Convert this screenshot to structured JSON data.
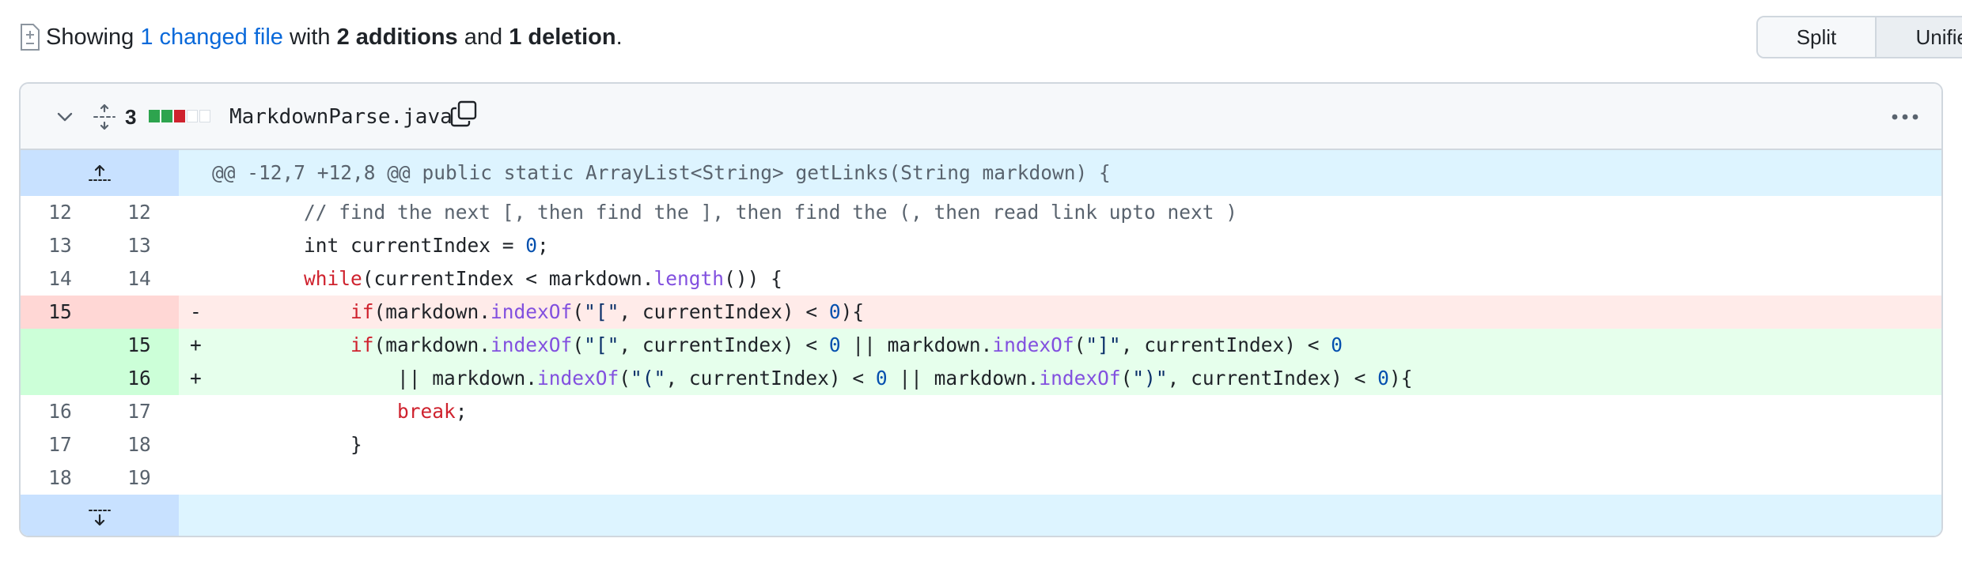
{
  "summary": {
    "prefix": "Showing ",
    "changed_link": "1 changed file",
    "mid1": " with ",
    "additions": "2 additions",
    "mid2": " and ",
    "deletions": "1 deletion",
    "suffix": "."
  },
  "view_toggle": {
    "split": "Split",
    "unified": "Unified",
    "selected": "Unified"
  },
  "file": {
    "change_count": "3",
    "filename": "MarkdownParse.java",
    "diffstat": [
      "green",
      "green",
      "red",
      "gray",
      "gray"
    ],
    "colors": {
      "green": "#2da44e",
      "red": "#cf222e",
      "gray": "#d8dee4"
    }
  },
  "hunk": {
    "header": "@@ -12,7 +12,8 @@ public static ArrayList<String> getLinks(String markdown) {"
  },
  "lines": [
    {
      "type": "ctx",
      "old": "12",
      "new": "12",
      "sign": "",
      "tokens": [
        {
          "t": "        ",
          "c": ""
        },
        {
          "t": "// find the next [, then find the ], then find the (, then read link upto next )",
          "c": "cm"
        }
      ]
    },
    {
      "type": "ctx",
      "old": "13",
      "new": "13",
      "sign": "",
      "tokens": [
        {
          "t": "        int currentIndex = ",
          "c": ""
        },
        {
          "t": "0",
          "c": "num"
        },
        {
          "t": ";",
          "c": ""
        }
      ]
    },
    {
      "type": "ctx",
      "old": "14",
      "new": "14",
      "sign": "",
      "tokens": [
        {
          "t": "        ",
          "c": ""
        },
        {
          "t": "while",
          "c": "kw"
        },
        {
          "t": "(currentIndex < markdown.",
          "c": ""
        },
        {
          "t": "length",
          "c": "fn"
        },
        {
          "t": "()) {",
          "c": ""
        }
      ]
    },
    {
      "type": "del",
      "old": "15",
      "new": "",
      "sign": "-",
      "tokens": [
        {
          "t": "            ",
          "c": ""
        },
        {
          "t": "if",
          "c": "kw"
        },
        {
          "t": "(markdown.",
          "c": ""
        },
        {
          "t": "indexOf",
          "c": "fn"
        },
        {
          "t": "(",
          "c": ""
        },
        {
          "t": "\"[\"",
          "c": "str"
        },
        {
          "t": ", currentIndex) < ",
          "c": ""
        },
        {
          "t": "0",
          "c": "num"
        },
        {
          "t": "){",
          "c": ""
        }
      ]
    },
    {
      "type": "add",
      "old": "",
      "new": "15",
      "sign": "+",
      "tokens": [
        {
          "t": "            ",
          "c": ""
        },
        {
          "t": "if",
          "c": "kw"
        },
        {
          "t": "(markdown.",
          "c": ""
        },
        {
          "t": "indexOf",
          "c": "fn"
        },
        {
          "t": "(",
          "c": ""
        },
        {
          "t": "\"[\"",
          "c": "str"
        },
        {
          "t": ", currentIndex) < ",
          "c": ""
        },
        {
          "t": "0",
          "c": "num"
        },
        {
          "t": " || markdown.",
          "c": ""
        },
        {
          "t": "indexOf",
          "c": "fn"
        },
        {
          "t": "(",
          "c": ""
        },
        {
          "t": "\"]\"",
          "c": "str"
        },
        {
          "t": ", currentIndex) < ",
          "c": ""
        },
        {
          "t": "0",
          "c": "num"
        }
      ]
    },
    {
      "type": "add",
      "old": "",
      "new": "16",
      "sign": "+",
      "tokens": [
        {
          "t": "                || markdown.",
          "c": ""
        },
        {
          "t": "indexOf",
          "c": "fn"
        },
        {
          "t": "(",
          "c": ""
        },
        {
          "t": "\"(\"",
          "c": "str"
        },
        {
          "t": ", currentIndex) < ",
          "c": ""
        },
        {
          "t": "0",
          "c": "num"
        },
        {
          "t": " || markdown.",
          "c": ""
        },
        {
          "t": "indexOf",
          "c": "fn"
        },
        {
          "t": "(",
          "c": ""
        },
        {
          "t": "\")\"",
          "c": "str"
        },
        {
          "t": ", currentIndex) < ",
          "c": ""
        },
        {
          "t": "0",
          "c": "num"
        },
        {
          "t": "){",
          "c": ""
        }
      ]
    },
    {
      "type": "ctx",
      "old": "16",
      "new": "17",
      "sign": "",
      "tokens": [
        {
          "t": "                ",
          "c": ""
        },
        {
          "t": "break",
          "c": "kw"
        },
        {
          "t": ";",
          "c": ""
        }
      ]
    },
    {
      "type": "ctx",
      "old": "17",
      "new": "18",
      "sign": "",
      "tokens": [
        {
          "t": "            }",
          "c": ""
        }
      ]
    },
    {
      "type": "ctx",
      "old": "18",
      "new": "19",
      "sign": "",
      "tokens": [
        {
          "t": "",
          "c": ""
        }
      ]
    }
  ],
  "icons": {
    "file_diff": "file-diff-icon",
    "chevron": "chevron-down-icon",
    "expand_all": "unfold-icon",
    "copy": "copy-icon",
    "kebab": "kebab-horizontal-icon",
    "expand_up": "fold-up-icon",
    "expand_down": "fold-down-icon"
  }
}
